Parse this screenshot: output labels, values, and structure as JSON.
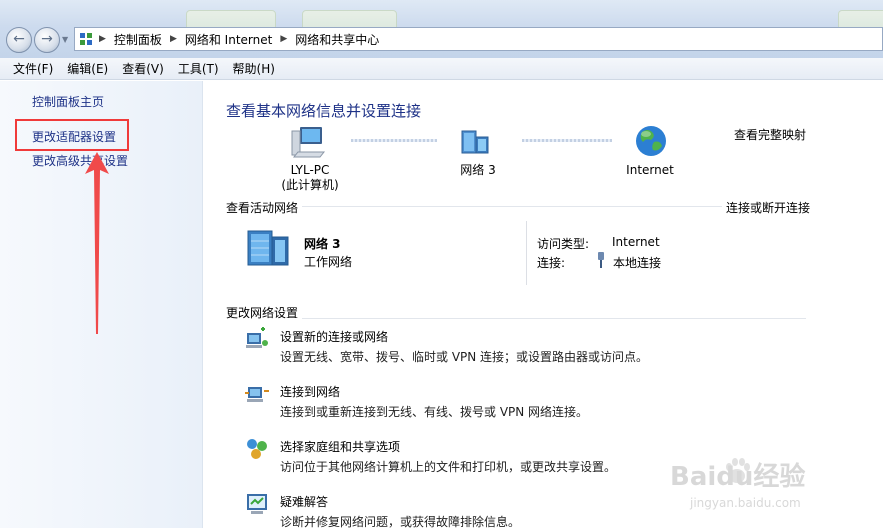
{
  "breadcrumb": {
    "items": [
      "控制面板",
      "网络和 Internet",
      "网络和共享中心"
    ]
  },
  "menubar": {
    "items": [
      "文件(F)",
      "编辑(E)",
      "查看(V)",
      "工具(T)",
      "帮助(H)"
    ]
  },
  "sidebar": {
    "items": [
      "控制面板主页",
      "更改适配器设置",
      "更改高级共享设置"
    ]
  },
  "main": {
    "title": "查看基本网络信息并设置连接",
    "full_map_link": "查看完整映射",
    "map": {
      "node1_line1": "LYL-PC",
      "node1_line2": "(此计算机)",
      "node2": "网络 3",
      "node3": "Internet"
    },
    "active_section": {
      "label": "查看活动网络",
      "action_link": "连接或断开连接",
      "network_name": "网络 3",
      "network_type": "工作网络",
      "access_type_label": "访问类型:",
      "access_type_value": "Internet",
      "connection_label": "连接:",
      "connection_value": "本地连接"
    },
    "change_section": {
      "label": "更改网络设置",
      "tasks": [
        {
          "title": "设置新的连接或网络",
          "desc": "设置无线、宽带、拨号、临时或 VPN 连接；或设置路由器或访问点。"
        },
        {
          "title": "连接到网络",
          "desc": "连接到或重新连接到无线、有线、拨号或 VPN 网络连接。"
        },
        {
          "title": "选择家庭组和共享选项",
          "desc": "访问位于其他网络计算机上的文件和打印机，或更改共享设置。"
        },
        {
          "title": "疑难解答",
          "desc": "诊断并修复网络问题，或获得故障排除信息。"
        }
      ]
    }
  },
  "watermark": {
    "brand": "Baidu经验",
    "url": "jingyan.baidu.com"
  },
  "colors": {
    "link": "#1e5aa8",
    "highlight": "#f03a3a"
  }
}
